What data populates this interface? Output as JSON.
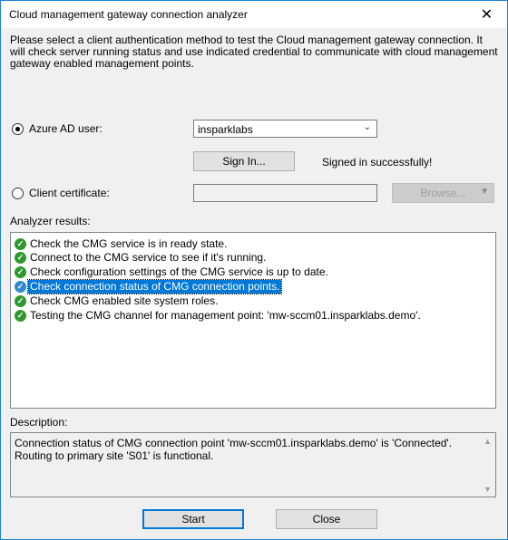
{
  "window": {
    "title": "Cloud management gateway connection analyzer",
    "close_glyph": "✕"
  },
  "intro": "Please select a client authentication method to test the Cloud management gateway connection. It will check server running status and use indicated credential to communicate with cloud management gateway enabled management points.",
  "azure": {
    "label": "Azure AD user:",
    "selected": true,
    "dropdown_value": "insparklabs",
    "sign_in_label": "Sign In...",
    "status": "Signed in successfully!"
  },
  "certificate": {
    "label": "Client certificate:",
    "selected": false,
    "value": "",
    "browse_label": "Browse..."
  },
  "results": {
    "label": "Analyzer results:",
    "items": [
      {
        "text": "Check the CMG service is in ready state.",
        "selected": false
      },
      {
        "text": "Connect to the CMG service to see if it's running.",
        "selected": false
      },
      {
        "text": "Check configuration settings of the CMG service is up to date.",
        "selected": false
      },
      {
        "text": "Check connection status of CMG connection points.",
        "selected": true
      },
      {
        "text": "Check CMG enabled site system roles.",
        "selected": false
      },
      {
        "text": "Testing the CMG channel for management point: 'mw-sccm01.insparklabs.demo'.",
        "selected": false
      }
    ]
  },
  "description": {
    "label": "Description:",
    "text": "Connection status of CMG connection point 'mw-sccm01.insparklabs.demo' is 'Connected'. Routing to primary site 'S01' is functional."
  },
  "buttons": {
    "start": "Start",
    "close": "Close"
  },
  "icons": {
    "check": "check-circle-icon",
    "dropdown": "chevron-down-icon"
  },
  "colors": {
    "accent": "#0078d7",
    "check_green": "#2e9a2e",
    "selection": "#0078d7"
  }
}
